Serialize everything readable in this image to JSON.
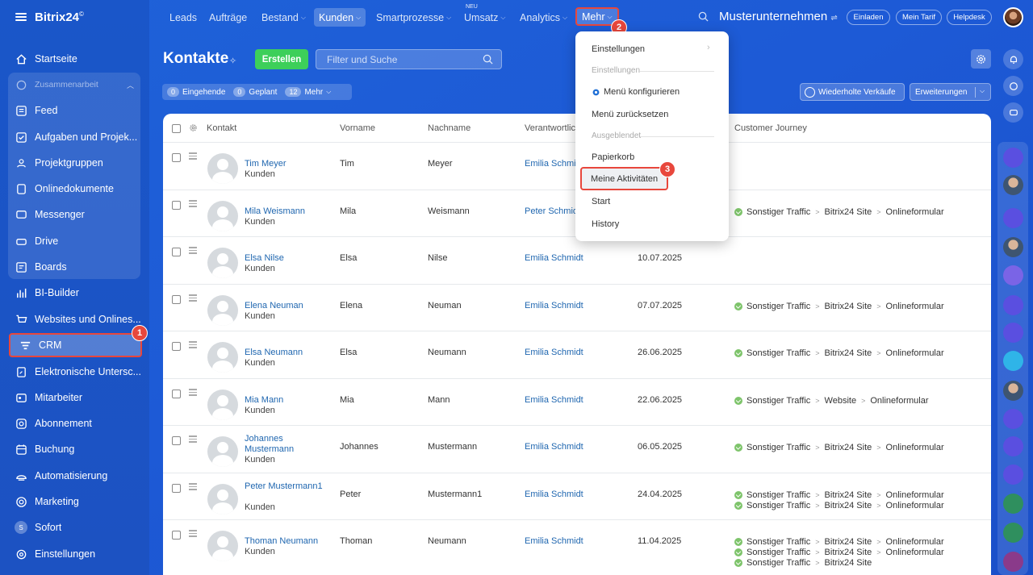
{
  "app": {
    "logo": "Bitrix24",
    "logo_mark": "©"
  },
  "sidebar": {
    "items": [
      {
        "label": "Startseite",
        "icon": "home-icon"
      },
      {
        "label": "Zusammenarbeit",
        "icon": "collab-icon"
      },
      {
        "label": "Feed",
        "icon": "feed-icon"
      },
      {
        "label": "Aufgaben und Projek...",
        "icon": "tasks-icon"
      },
      {
        "label": "Projektgruppen",
        "icon": "groups-icon"
      },
      {
        "label": "Onlinedokumente",
        "icon": "document-icon"
      },
      {
        "label": "Messenger",
        "icon": "messenger-icon"
      },
      {
        "label": "Drive",
        "icon": "drive-icon"
      },
      {
        "label": "Boards",
        "icon": "boards-icon"
      },
      {
        "label": "BI-Builder",
        "icon": "chart-icon"
      },
      {
        "label": "Websites und Onlines...",
        "icon": "cart-icon"
      },
      {
        "label": "CRM",
        "icon": "crm-icon"
      },
      {
        "label": "Elektronische Untersc...",
        "icon": "signature-icon"
      },
      {
        "label": "Mitarbeiter",
        "icon": "employees-icon"
      },
      {
        "label": "Abonnement",
        "icon": "subscription-icon"
      },
      {
        "label": "Buchung",
        "icon": "calendar-icon"
      },
      {
        "label": "Automatisierung",
        "icon": "automation-icon"
      },
      {
        "label": "Marketing",
        "icon": "marketing-icon"
      },
      {
        "label": "Sofort",
        "icon": "sofort-icon"
      },
      {
        "label": "Einstellungen",
        "icon": "settings-icon"
      }
    ],
    "sofort_letter": "S"
  },
  "badges": {
    "one": "1",
    "two": "2",
    "three": "3"
  },
  "topnav": {
    "items": [
      "Leads",
      "Aufträge",
      "Bestand",
      "Kunden",
      "Smartprozesse",
      "Umsatz",
      "Analytics",
      "Mehr"
    ],
    "neu": "NEU",
    "company": "Musterunternehmen",
    "invite": "Einladen",
    "tariff": "Mein Tarif",
    "helpdesk": "Helpdesk"
  },
  "page": {
    "title": "Kontakte",
    "create": "Erstellen",
    "search_placeholder": "Filter und Suche"
  },
  "counters": {
    "incoming_count": "0",
    "incoming": "Eingehende",
    "planned_count": "0",
    "planned": "Geplant",
    "more_count": "12",
    "more": "Mehr"
  },
  "actions": {
    "repeat_sales": "Wiederholte Verkäufe",
    "extensions": "Erweiterungen"
  },
  "table": {
    "headers": [
      "Kontakt",
      "Vorname",
      "Nachname",
      "Verantwortlic",
      "Customer Journey"
    ],
    "rows": [
      {
        "name": "Tim Meyer",
        "type": "Kunden",
        "first": "Tim",
        "last": "Meyer",
        "resp": "Emilia Schmid",
        "date": "",
        "journey": []
      },
      {
        "name": "Mila Weismann",
        "type": "Kunden",
        "first": "Mila",
        "last": "Weismann",
        "resp": "Peter Schmid",
        "date": "",
        "journey": [
          [
            "Sonstiger Traffic",
            "Bitrix24 Site",
            "Onlineformular"
          ]
        ]
      },
      {
        "name": "Elsa Nilse",
        "type": "Kunden",
        "first": "Elsa",
        "last": "Nilse",
        "resp": "Emilia Schmidt",
        "date": "10.07.2025",
        "journey": []
      },
      {
        "name": "Elena Neuman",
        "type": "Kunden",
        "first": "Elena",
        "last": "Neuman",
        "resp": "Emilia Schmidt",
        "date": "07.07.2025",
        "journey": [
          [
            "Sonstiger Traffic",
            "Bitrix24 Site",
            "Onlineformular"
          ]
        ]
      },
      {
        "name": "Elsa Neumann",
        "type": "Kunden",
        "first": "Elsa",
        "last": "Neumann",
        "resp": "Emilia Schmidt",
        "date": "26.06.2025",
        "journey": [
          [
            "Sonstiger Traffic",
            "Bitrix24 Site",
            "Onlineformular"
          ]
        ]
      },
      {
        "name": "Mia Mann",
        "type": "Kunden",
        "first": "Mia",
        "last": "Mann",
        "resp": "Emilia Schmidt",
        "date": "22.06.2025",
        "journey": [
          [
            "Sonstiger Traffic",
            "Website",
            "Onlineformular"
          ]
        ]
      },
      {
        "name": "Johannes Mustermann",
        "type": "Kunden",
        "first": "Johannes",
        "last": "Mustermann",
        "resp": "Emilia Schmidt",
        "date": "06.05.2025",
        "journey": [
          [
            "Sonstiger Traffic",
            "Bitrix24 Site",
            "Onlineformular"
          ]
        ]
      },
      {
        "name": "Peter Mustermann1",
        "type": "Kunden",
        "first": "Peter",
        "last": "Mustermann1",
        "resp": "Emilia Schmidt",
        "date": "24.04.2025",
        "journey": [
          [
            "Sonstiger Traffic",
            "Bitrix24 Site",
            "Onlineformular"
          ],
          [
            "Sonstiger Traffic",
            "Bitrix24 Site",
            "Onlineformular"
          ]
        ]
      },
      {
        "name": "Thoman Neumann",
        "type": "Kunden",
        "first": "Thoman",
        "last": "Neumann",
        "resp": "Emilia Schmidt",
        "date": "11.04.2025",
        "journey": [
          [
            "Sonstiger Traffic",
            "Bitrix24 Site",
            "Onlineformular"
          ],
          [
            "Sonstiger Traffic",
            "Bitrix24 Site",
            "Onlineformular"
          ],
          [
            "Sonstiger Traffic",
            "Bitrix24 Site"
          ]
        ]
      }
    ]
  },
  "menu": {
    "settings": "Einstellungen",
    "section_settings": "Einstellungen",
    "configure": "Menü konfigurieren",
    "reset": "Menü zurücksetzen",
    "section_hidden": "Ausgeblendet",
    "trash": "Papierkorb",
    "activities": "Meine Aktivitäten",
    "start": "Start",
    "history": "History"
  },
  "colors": {
    "accent": "#1d5ad6",
    "highlight": "#e8473c",
    "create": "#3dcf5a",
    "link": "#2067b0"
  }
}
